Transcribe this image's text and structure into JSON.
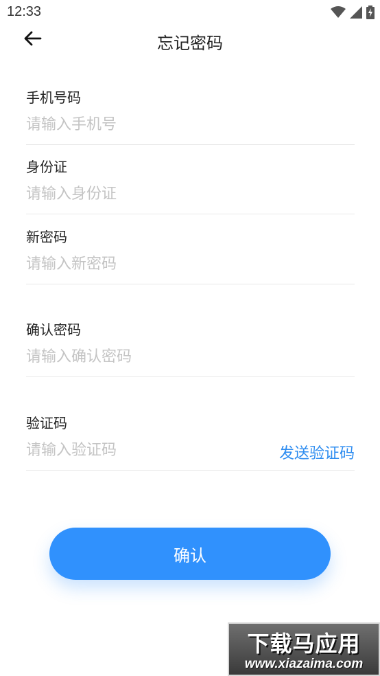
{
  "status_bar": {
    "time": "12:33",
    "icons": [
      "wifi-icon",
      "signal-icon",
      "battery-charging-icon"
    ]
  },
  "app_bar": {
    "back_icon": "back-arrow-icon",
    "title": "忘记密码"
  },
  "form": {
    "phone": {
      "label": "手机号码",
      "placeholder": "请输入手机号",
      "value": ""
    },
    "id_card": {
      "label": "身份证",
      "placeholder": "请输入身份证",
      "value": ""
    },
    "new_password": {
      "label": "新密码",
      "placeholder": "请输入新密码",
      "value": ""
    },
    "confirm_password": {
      "label": "确认密码",
      "placeholder": "请输入确认密码",
      "value": ""
    },
    "verify_code": {
      "label": "验证码",
      "placeholder": "请输入验证码",
      "value": "",
      "send_label": "发送验证码"
    }
  },
  "confirm_button": {
    "label": "确认"
  },
  "watermark": {
    "main": "下载马应用",
    "sub": "www.xiazaima.com"
  },
  "colors": {
    "accent": "#3091fd",
    "link": "#2d8cf0",
    "placeholder": "#c4c4c4",
    "divider": "#e8e8e8"
  }
}
